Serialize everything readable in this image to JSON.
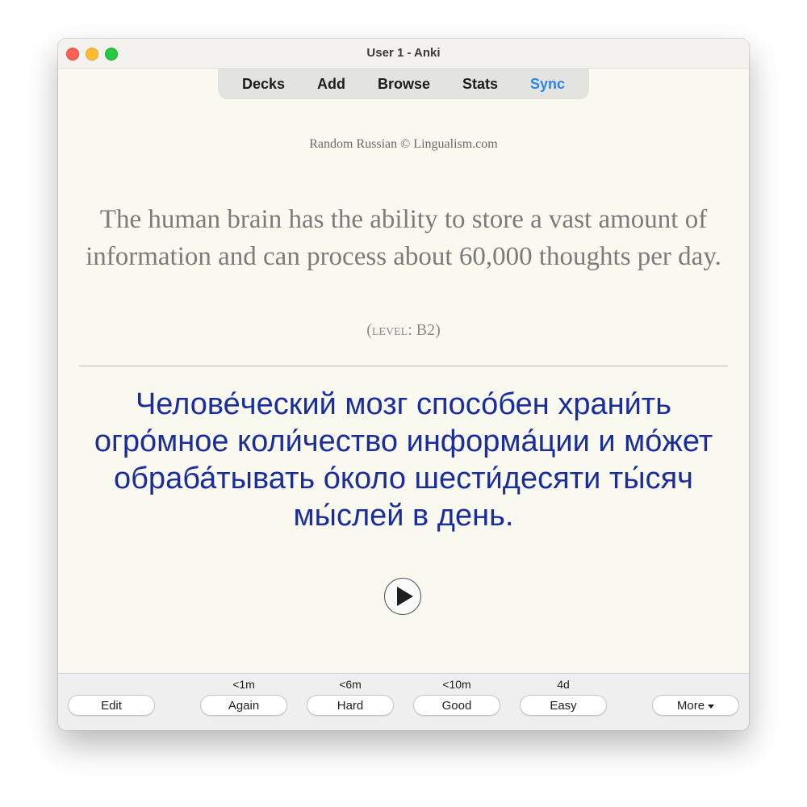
{
  "window": {
    "title": "User 1 - Anki"
  },
  "toolbar": {
    "tabs": [
      {
        "label": "Decks"
      },
      {
        "label": "Add"
      },
      {
        "label": "Browse"
      },
      {
        "label": "Stats"
      },
      {
        "label": "Sync"
      }
    ],
    "sync_color": "#2d86e6"
  },
  "card": {
    "credit": "Random Russian © Lingualism.com",
    "english": "The human brain has the ability to store a vast amount of information and can process about 60,000 thoughts per day.",
    "level_prefix": "(",
    "level_label": "level",
    "level_sep": ": ",
    "level_value": "B2",
    "level_suffix": ")",
    "russian": "Челове́ческий мозг спосо́бен храни́ть огро́мное коли́чество информа́ции и мо́жет обраба́тывать о́коло шести́десяти ты́сяч мы́слей в день.",
    "russian_color": "#1a2d9a",
    "audio_icon": "play-icon"
  },
  "answer_bar": {
    "edit_label": "Edit",
    "more_label": "More",
    "buttons": [
      {
        "label": "Again",
        "interval": "<1m"
      },
      {
        "label": "Hard",
        "interval": "<6m"
      },
      {
        "label": "Good",
        "interval": "<10m"
      },
      {
        "label": "Easy",
        "interval": "4d"
      }
    ]
  }
}
